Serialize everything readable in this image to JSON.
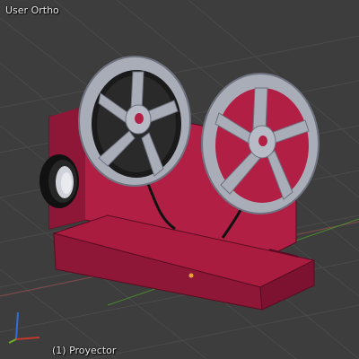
{
  "viewport": {
    "view_name": "User Ortho",
    "object_info": "(1) Proyector"
  },
  "colors": {
    "background": "#3d3d3d",
    "grid_line": "#4a4a4a",
    "x_axis": "#c0392b",
    "y_axis": "#6fae2a",
    "z_axis": "#2f6fd6",
    "body": "#b21f45",
    "body_dark": "#7c1230",
    "reel": "#a9adb8",
    "reel_dark": "#6f7380",
    "lens": "#111111",
    "origin": "#e8a23a"
  },
  "icons": {
    "gizmo": "axis-orientation-icon"
  }
}
